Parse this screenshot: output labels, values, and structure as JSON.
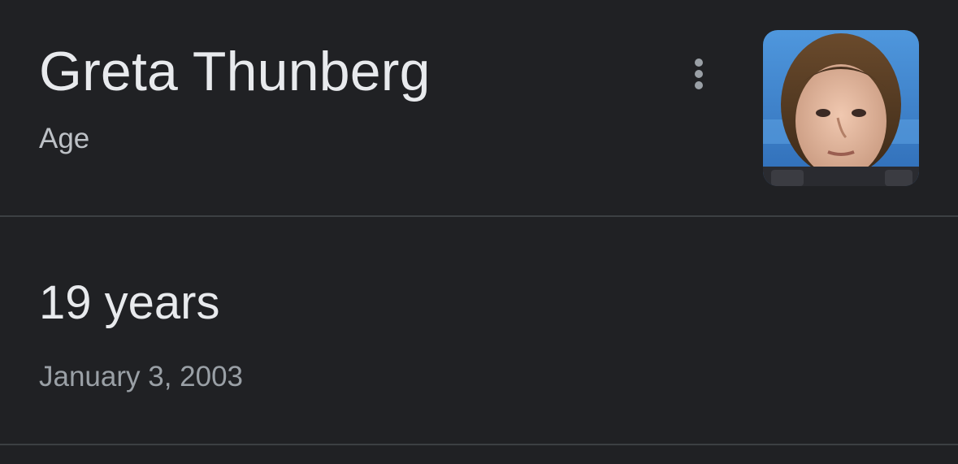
{
  "entity": {
    "name": "Greta Thunberg",
    "attribute": "Age"
  },
  "result": {
    "age": "19 years",
    "birth_date": "January 3, 2003"
  },
  "icons": {
    "more": "more-vert-icon",
    "thumbnail": "portrait-photo"
  },
  "colors": {
    "background": "#202124",
    "primary_text": "#e8eaed",
    "secondary_text": "#bdc1c6",
    "tertiary_text": "#9aa0a6",
    "divider": "#3c4043"
  }
}
